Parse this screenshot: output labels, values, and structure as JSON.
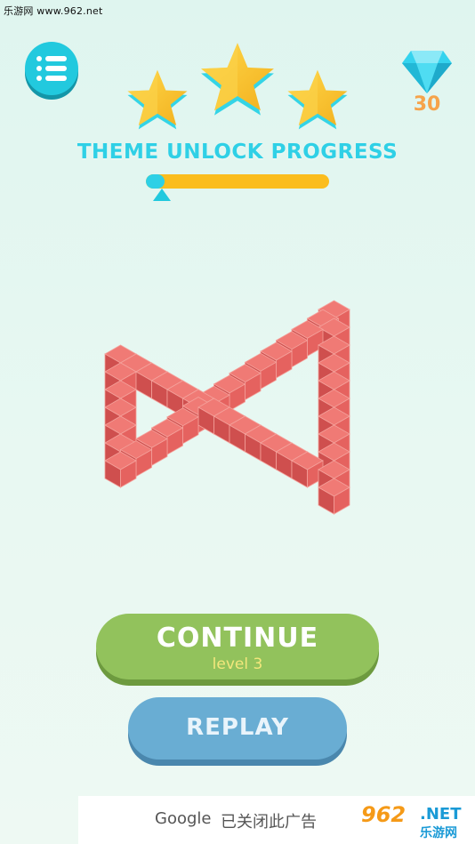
{
  "watermark": {
    "text": "乐游网 www.962.net"
  },
  "menu": {
    "icon": "list-menu-icon"
  },
  "stars": {
    "earned": 3,
    "total": 3,
    "color": "#f7c22b"
  },
  "gems": {
    "icon": "diamond-icon",
    "count": "30",
    "color": "#2fd0e6"
  },
  "progress": {
    "title": "THEME UNLOCK PROGRESS",
    "fraction": 0.1,
    "fill_color": "#2ed0e6",
    "track_color": "#fbbd1e"
  },
  "puzzle": {
    "shape": "impossible-triangle-of-cubes",
    "cube_color": "#e5625f"
  },
  "buttons": {
    "continue_label": "CONTINUE",
    "continue_sub": "level 3",
    "replay_label": "REPLAY"
  },
  "ad": {
    "google": "Google",
    "closed_text": "已关闭此广告"
  },
  "site_logo": {
    "main": "962",
    "net": ".NET",
    "cn": "乐游网"
  }
}
